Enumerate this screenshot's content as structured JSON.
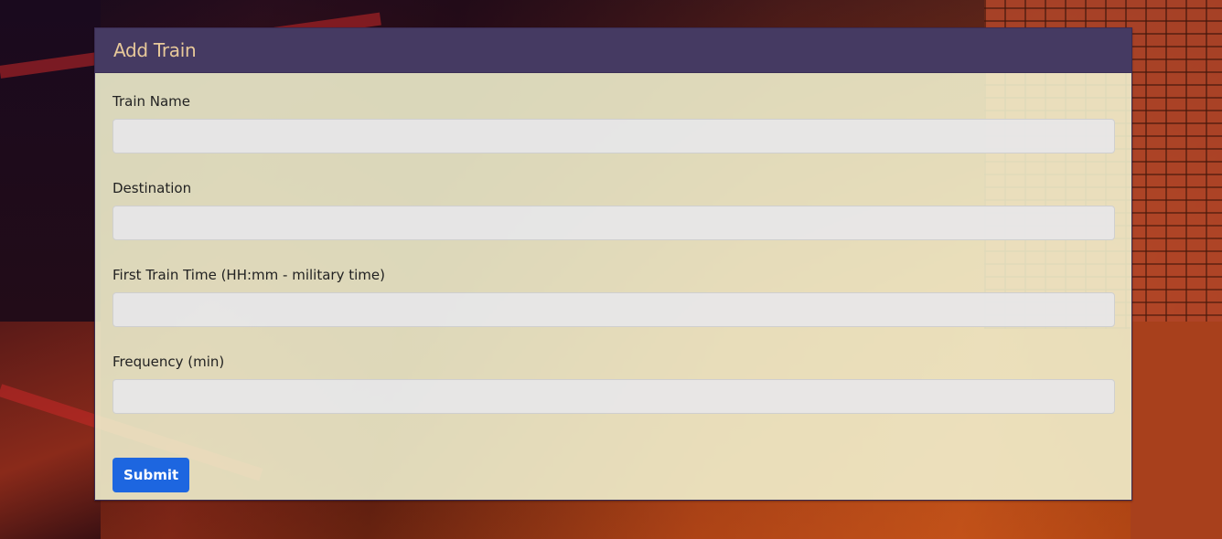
{
  "panel": {
    "title": "Add Train"
  },
  "form": {
    "fields": [
      {
        "label": "Train Name",
        "value": ""
      },
      {
        "label": "Destination",
        "value": ""
      },
      {
        "label": "First Train Time (HH:mm - military time)",
        "value": ""
      },
      {
        "label": "Frequency (min)",
        "value": ""
      }
    ],
    "submit_label": "Submit"
  },
  "colors": {
    "header_bg": "#453a62",
    "header_text": "#e8c99a",
    "panel_bg": "#f2f4d2",
    "button_bg": "#1d66e0"
  }
}
